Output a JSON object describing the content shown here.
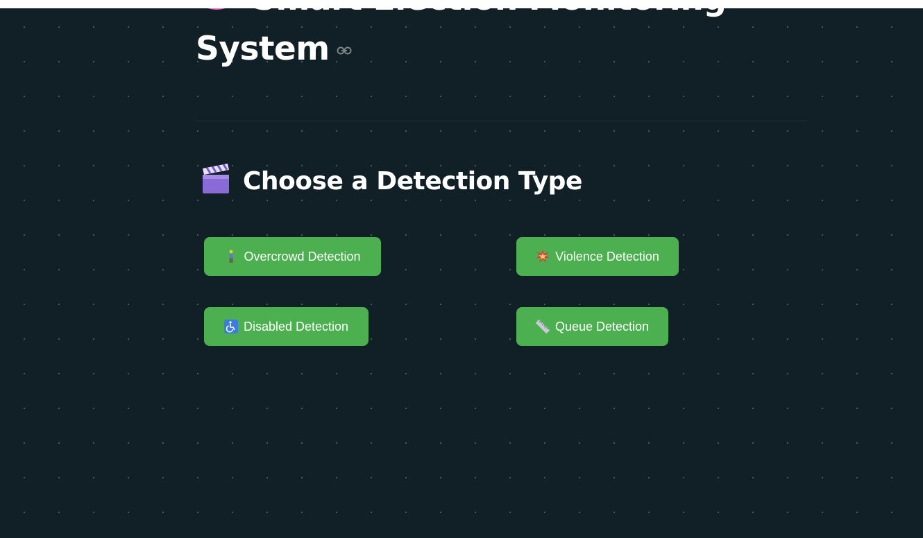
{
  "page": {
    "title": "Smart Election Monitoring System",
    "title_icon": "brain-icon",
    "subtitle": "Choose a Detection Type",
    "subtitle_icon": "clapper-board-icon"
  },
  "buttons": [
    {
      "label": "Overcrowd Detection",
      "icon": "person-standing-icon"
    },
    {
      "label": "Violence Detection",
      "icon": "collision-icon"
    },
    {
      "label": "Disabled Detection",
      "icon": "wheelchair-icon"
    },
    {
      "label": "Queue Detection",
      "icon": "ruler-icon"
    }
  ],
  "colors": {
    "background": "#111f26",
    "button": "#4caf50",
    "text": "#ffffff",
    "top_bar": "#ffffff"
  }
}
